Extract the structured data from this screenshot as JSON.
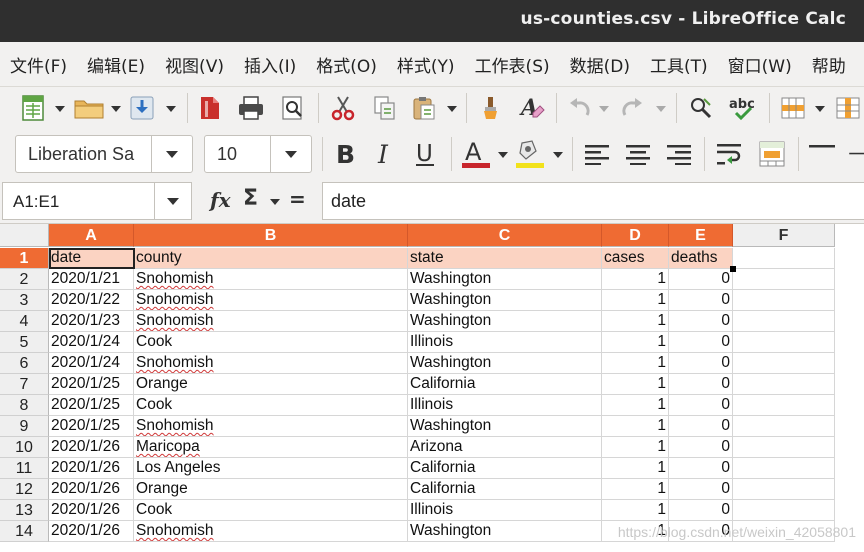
{
  "window": {
    "title": "us-counties.csv - LibreOffice Calc"
  },
  "menu": [
    "文件(F)",
    "编辑(E)",
    "视图(V)",
    "插入(I)",
    "格式(O)",
    "样式(Y)",
    "工作表(S)",
    "数据(D)",
    "工具(T)",
    "窗口(W)",
    "帮助"
  ],
  "toolbar": {
    "font_name": "Liberation Sa",
    "font_size": "10"
  },
  "formula_bar": {
    "name_box": "A1:E1",
    "fx_label": "fx",
    "sigma_label": "Σ",
    "equals_label": "=",
    "content": "date"
  },
  "grid": {
    "columns": [
      "A",
      "B",
      "C",
      "D",
      "E",
      "F"
    ],
    "rows": [
      {
        "num": "1",
        "cells": [
          "date",
          "county",
          "state",
          "cases",
          "deaths"
        ]
      },
      {
        "num": "2",
        "cells": [
          "2020/1/21",
          "Snohomish",
          "Washington",
          "1",
          "0"
        ]
      },
      {
        "num": "3",
        "cells": [
          "2020/1/22",
          "Snohomish",
          "Washington",
          "1",
          "0"
        ]
      },
      {
        "num": "4",
        "cells": [
          "2020/1/23",
          "Snohomish",
          "Washington",
          "1",
          "0"
        ]
      },
      {
        "num": "5",
        "cells": [
          "2020/1/24",
          "Cook",
          "Illinois",
          "1",
          "0"
        ]
      },
      {
        "num": "6",
        "cells": [
          "2020/1/24",
          "Snohomish",
          "Washington",
          "1",
          "0"
        ]
      },
      {
        "num": "7",
        "cells": [
          "2020/1/25",
          "Orange",
          "California",
          "1",
          "0"
        ]
      },
      {
        "num": "8",
        "cells": [
          "2020/1/25",
          "Cook",
          "Illinois",
          "1",
          "0"
        ]
      },
      {
        "num": "9",
        "cells": [
          "2020/1/25",
          "Snohomish",
          "Washington",
          "1",
          "0"
        ]
      },
      {
        "num": "10",
        "cells": [
          "2020/1/26",
          "Maricopa",
          "Arizona",
          "1",
          "0"
        ]
      },
      {
        "num": "11",
        "cells": [
          "2020/1/26",
          "Los Angeles",
          "California",
          "1",
          "0"
        ]
      },
      {
        "num": "12",
        "cells": [
          "2020/1/26",
          "Orange",
          "California",
          "1",
          "0"
        ]
      },
      {
        "num": "13",
        "cells": [
          "2020/1/26",
          "Cook",
          "Illinois",
          "1",
          "0"
        ]
      },
      {
        "num": "14",
        "cells": [
          "2020/1/26",
          "Snohomish",
          "Washington",
          "1",
          "0"
        ]
      }
    ],
    "misspelled": [
      "Snohomish",
      "Maricopa"
    ]
  },
  "watermark": "https://blog.csdn.net/weixin_42058801",
  "colors": {
    "accent": "#ef6b33",
    "selected_fill": "#fbd3c2",
    "titlebar": "#2f2f2f"
  }
}
